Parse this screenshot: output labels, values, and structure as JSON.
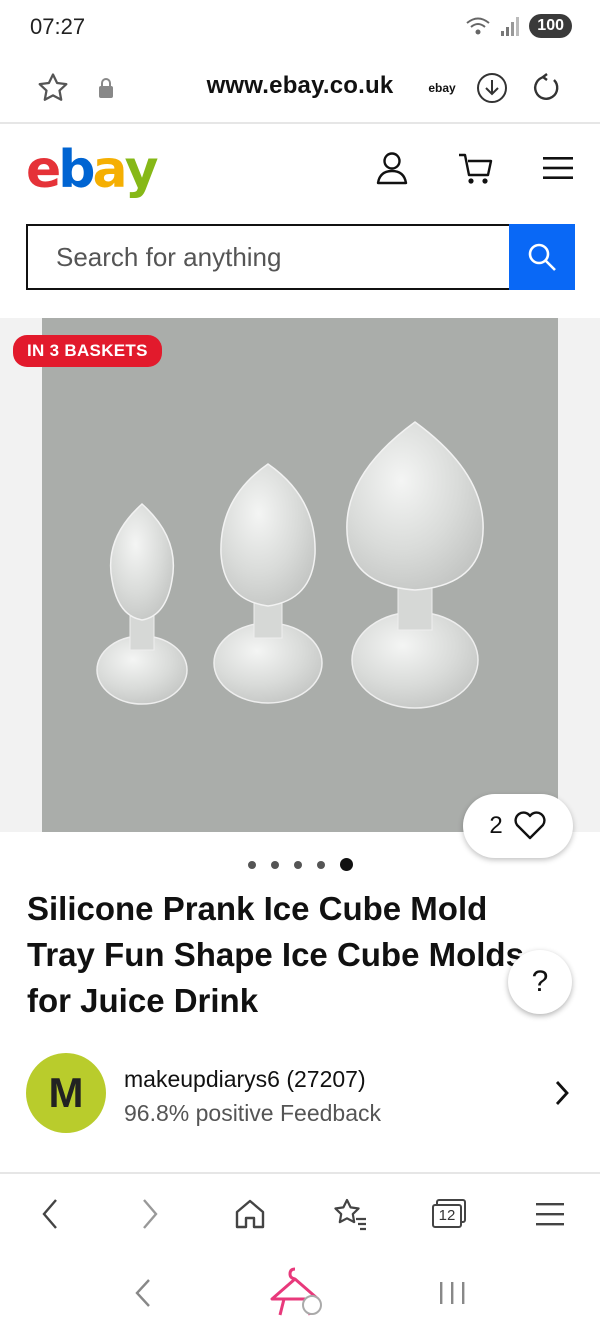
{
  "status_bar": {
    "time": "07:27",
    "battery": "100"
  },
  "browser": {
    "url": "www.ebay.co.uk",
    "site_badge": "ebay"
  },
  "ebay_header": {
    "logo_letters": [
      "e",
      "b",
      "a",
      "y"
    ],
    "logo_colors": [
      "#e53238",
      "#0064d2",
      "#f5af02",
      "#86b817"
    ]
  },
  "search": {
    "placeholder": "Search for anything",
    "accent": "#0968f6"
  },
  "listing": {
    "badge": "IN 3 BASKETS",
    "watch_count": "2",
    "gallery_total": 5,
    "gallery_active": 5,
    "title": "Silicone Prank Ice Cube Mold Tray Fun Shape Ice Cube Molds for Juice Drink",
    "help": "?"
  },
  "seller": {
    "avatar_letter": "M",
    "name": "makeupdiarys6 (27207)",
    "feedback": "96.8% positive Feedback"
  },
  "browser_nav": {
    "tab_count": "12",
    "icons": [
      "back-icon",
      "forward-icon",
      "home-icon",
      "bookmarks-icon",
      "tabs-icon",
      "menu-icon"
    ]
  },
  "system_nav": {
    "icons": [
      "back-icon",
      "assistant-icon",
      "recent-apps-icon"
    ]
  }
}
